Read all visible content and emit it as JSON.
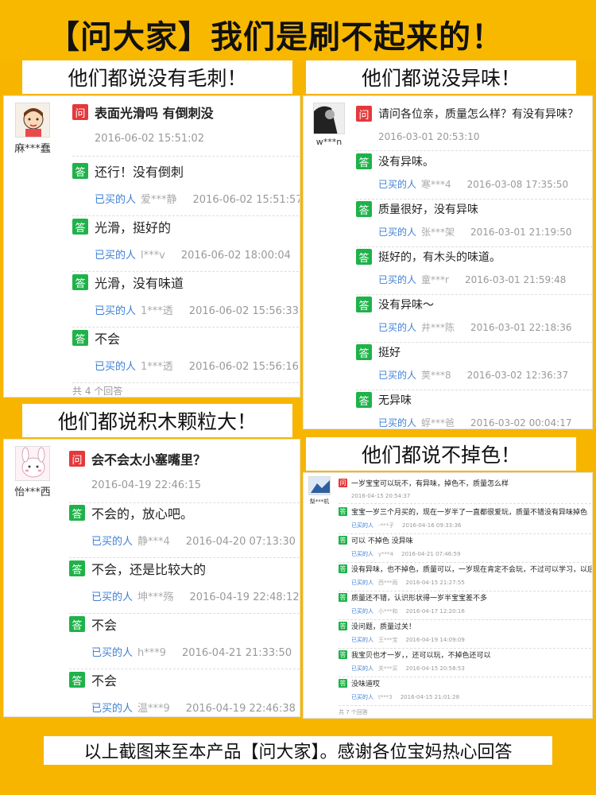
{
  "header": {
    "title": "【问大家】我们是刷不起来的！"
  },
  "banners": {
    "b1": "他们都说没有毛刺！",
    "b2": "他们都说没异味！",
    "b3": "他们都说积木颗粒大！",
    "b4": "他们都说不掉色！"
  },
  "footer": "以上截图来至本产品【问大家】。感谢各位宝妈热心回答",
  "tags": {
    "q": "问",
    "a": "答"
  },
  "buyer_label": "已买的人",
  "panel1": {
    "user": "麻***蠢",
    "question": "表面光滑吗 有倒刺没",
    "q_time": "2016-06-02 15:51:02",
    "answers": [
      {
        "text": "还行！没有倒刺",
        "user": "爱***静",
        "time": "2016-06-02 15:51:57"
      },
      {
        "text": "光滑，挺好的",
        "user": "l***v",
        "time": "2016-06-02 18:00:04"
      },
      {
        "text": "光滑，没有味道",
        "user": "1***透",
        "time": "2016-06-02 15:56:33"
      },
      {
        "text": "不会",
        "user": "1***透",
        "time": "2016-06-02 15:56:16"
      }
    ],
    "count": "共 4 个回答"
  },
  "panel2": {
    "user": "w***n",
    "question": "请问各位亲，质量怎么样？有没有异味？",
    "q_time": "2016-03-01 20:53:10",
    "answers": [
      {
        "text": "没有异味。",
        "user": "寒***4",
        "time": "2016-03-08 17:35:50"
      },
      {
        "text": "质量很好，没有异味",
        "user": "张***架",
        "time": "2016-03-01 21:19:50"
      },
      {
        "text": "挺好的，有木头的味道。",
        "user": "童***r",
        "time": "2016-03-01 21:59:48"
      },
      {
        "text": "没有异味～",
        "user": "井***陈",
        "time": "2016-03-01 22:18:36"
      },
      {
        "text": "挺好",
        "user": "荚***8",
        "time": "2016-03-02 12:36:37"
      },
      {
        "text": "无异味",
        "user": "蜉***爸",
        "time": "2016-03-02 00:04:17"
      }
    ]
  },
  "panel3": {
    "user": "怡***西",
    "question": "会不会太小塞嘴里？",
    "q_time": "2016-04-19 22:46:15",
    "answers": [
      {
        "text": "不会的，放心吧。",
        "user": "静***4",
        "time": "2016-04-20 07:13:30"
      },
      {
        "text": "不会，还是比较大的",
        "user": "坤***殇",
        "time": "2016-04-19 22:48:12"
      },
      {
        "text": "不会",
        "user": "h***9",
        "time": "2016-04-21 21:33:50"
      },
      {
        "text": "不会",
        "user": "温***9",
        "time": "2016-04-19 22:46:38"
      }
    ]
  },
  "panel4": {
    "user": "梨***机",
    "question": "一岁宝宝可以玩不，有异味，掉色不，质量怎么样",
    "q_time": "2016-04-15 20:54:37",
    "answers": [
      {
        "text": "宝宝一岁三个月买的，现在一岁半了一直都很爱玩，质量不错没有异味掉色",
        "user": "-***子",
        "time": "2016-04-16 09:33:36"
      },
      {
        "text": "可以 不掉色 没异味",
        "user": "y***4",
        "time": "2016-04-21 07:46:59"
      },
      {
        "text": "没有异味，也不掉色，质量可以，一岁现在肯定不会玩，不过可以学习，以后用得上",
        "user": "西***雨",
        "time": "2016-04-15 21:27:55"
      },
      {
        "text": "质量还不错，认识形状得一岁半宝宝差不多",
        "user": "小***和",
        "time": "2016-04-17 12:20:16"
      },
      {
        "text": "没问题，质量过关！",
        "user": "王***宝",
        "time": "2016-04-19 14:09:09"
      },
      {
        "text": "我宝贝也才一岁，，还可以玩，不掉色还可以",
        "user": "关***买",
        "time": "2016-04-15 20:58:53"
      },
      {
        "text": "没味道哎",
        "user": "t***3",
        "time": "2016-04-15 21:01:28"
      }
    ],
    "count": "共 7 个回答"
  }
}
